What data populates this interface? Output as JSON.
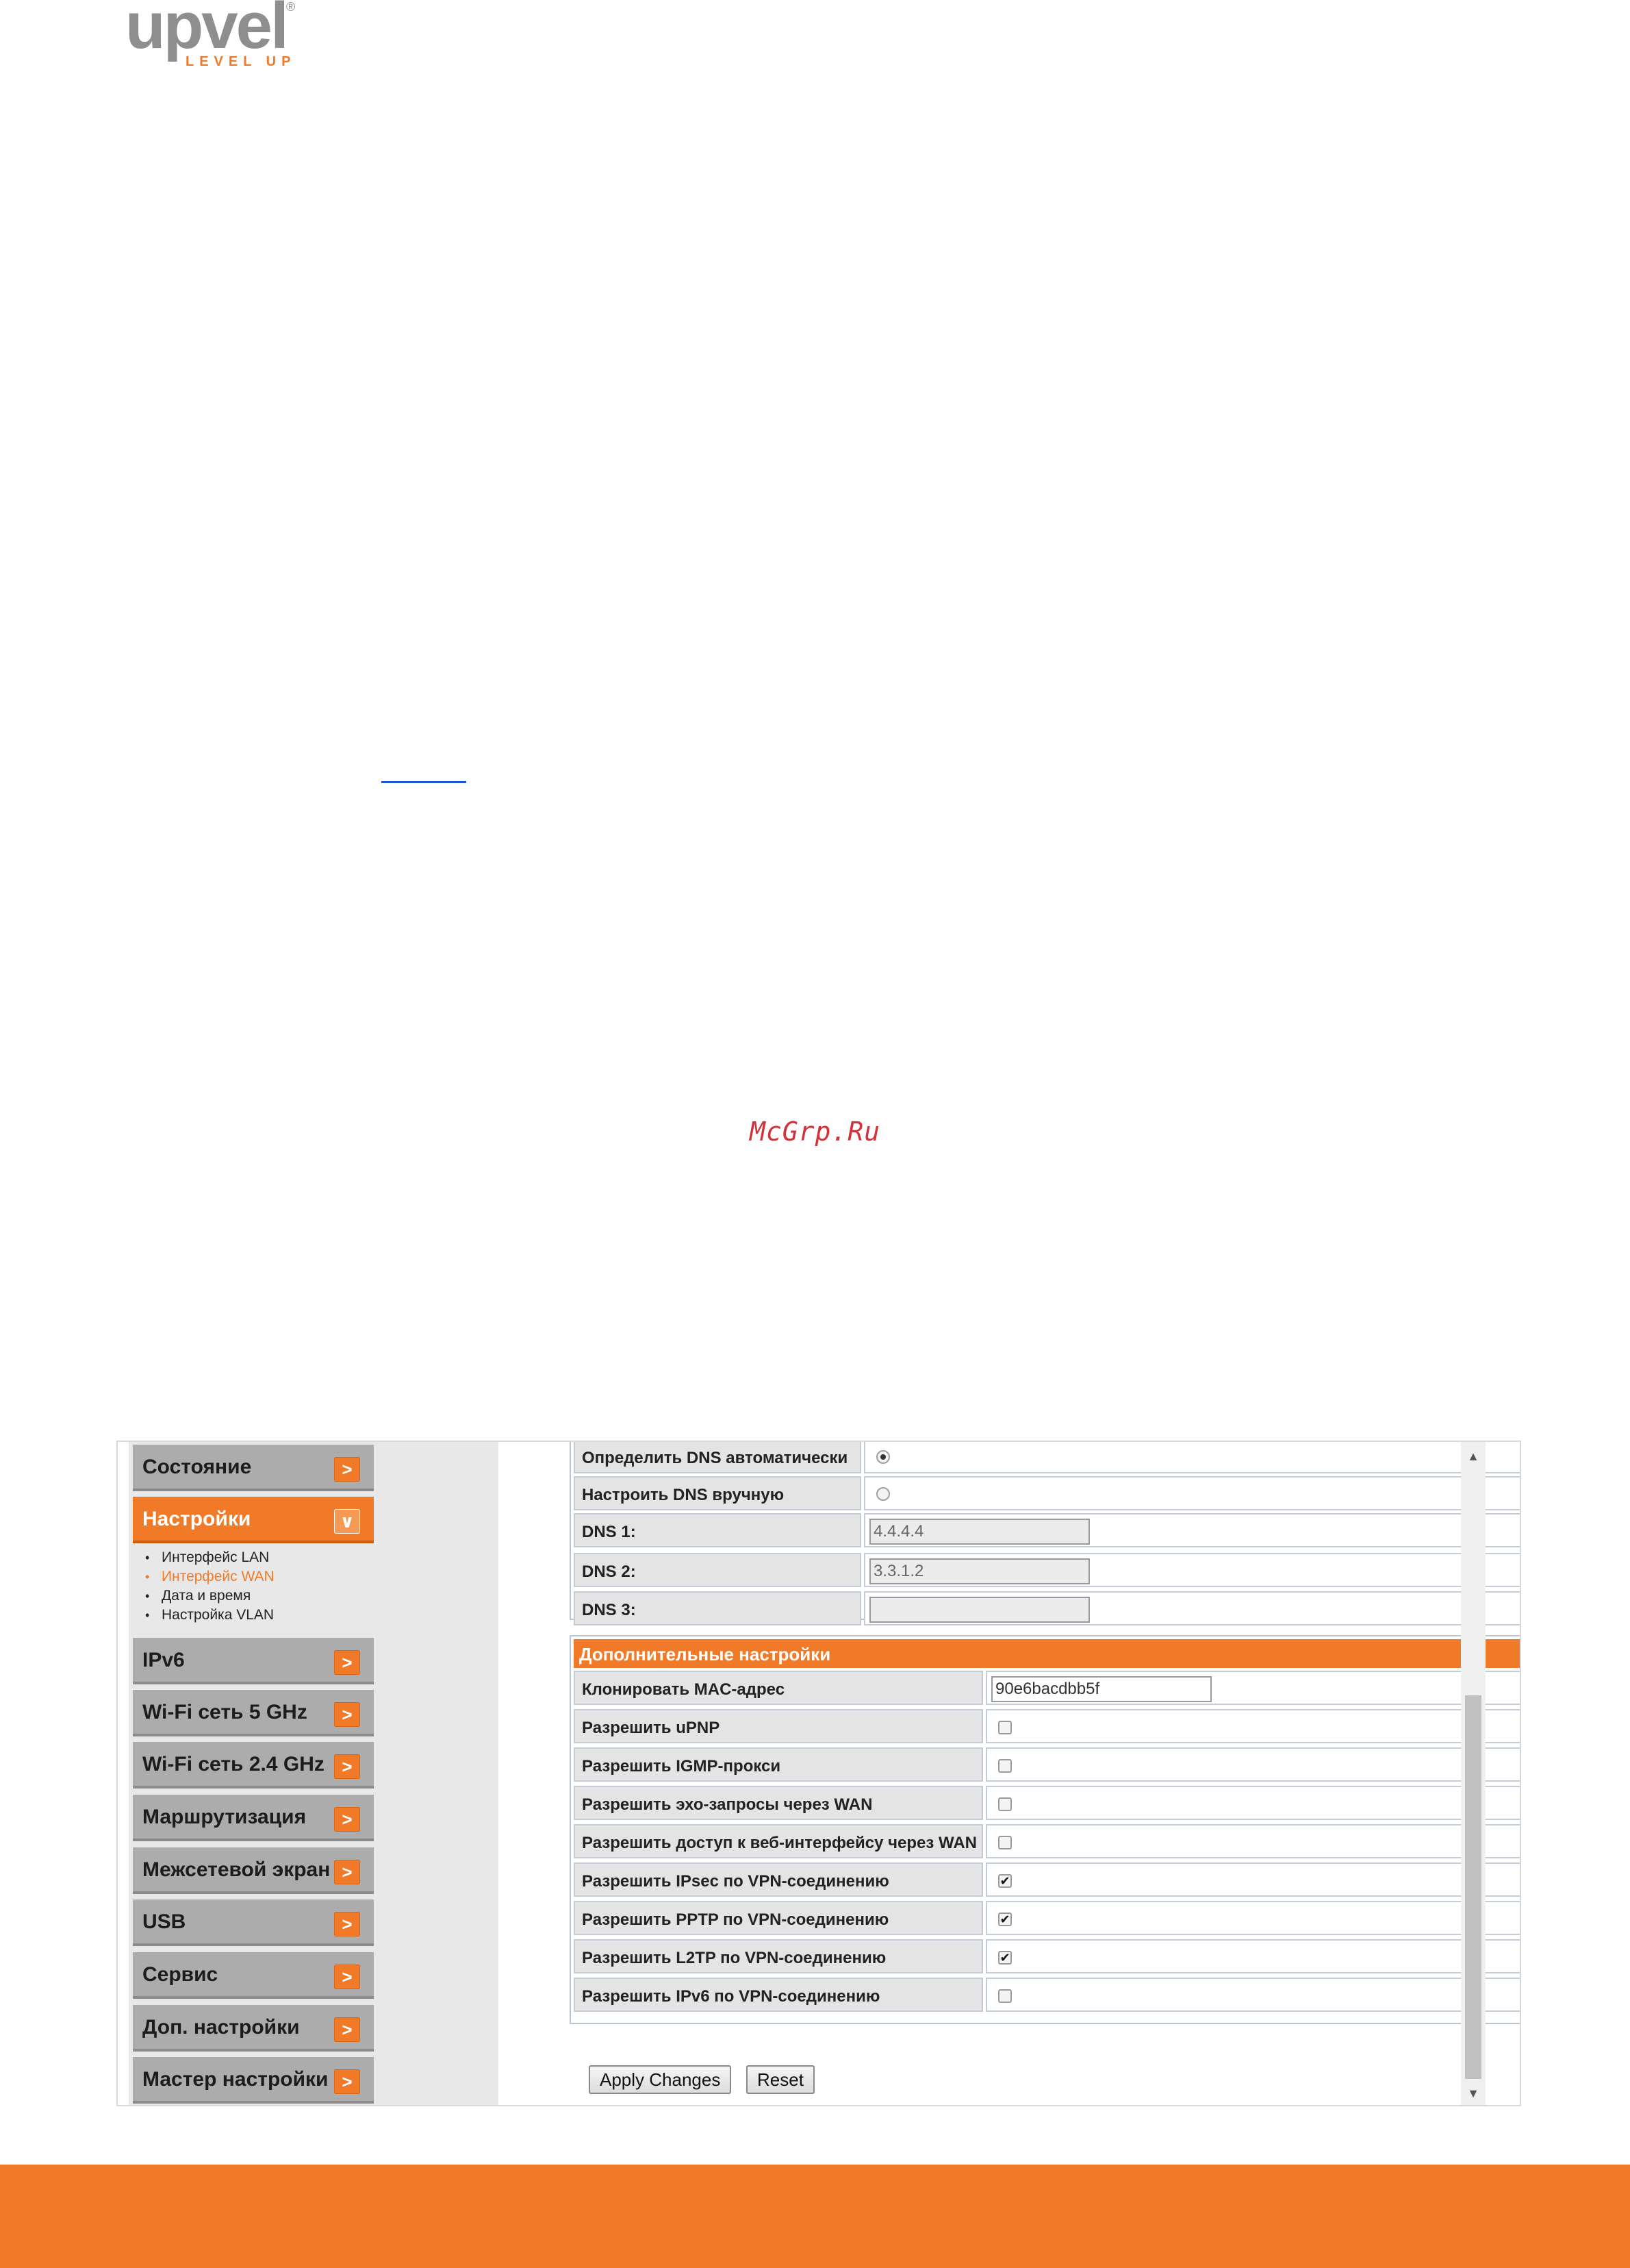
{
  "logo": {
    "word": "upvel",
    "registered": "®",
    "tagline": "LEVEL UP"
  },
  "watermark": "McGrp.Ru",
  "sidebar": {
    "items": [
      {
        "label": "Состояние",
        "arrow": ">"
      },
      {
        "label": "Настройки",
        "arrow": "∨"
      },
      {
        "label": "IPv6",
        "arrow": ">"
      },
      {
        "label": "Wi-Fi сеть 5 GHz",
        "arrow": ">"
      },
      {
        "label": "Wi-Fi сеть 2.4 GHz",
        "arrow": ">"
      },
      {
        "label": "Маршрутизация",
        "arrow": ">"
      },
      {
        "label": "Межсетевой экран",
        "arrow": ">"
      },
      {
        "label": "USB",
        "arrow": ">"
      },
      {
        "label": "Сервис",
        "arrow": ">"
      },
      {
        "label": "Доп. настройки",
        "arrow": ">"
      },
      {
        "label": "Мастер настройки",
        "arrow": ">"
      }
    ],
    "submenu": [
      "Интерфейс LAN",
      "Интерфейс WAN",
      "Дата и время",
      "Настройка VLAN"
    ]
  },
  "dns": {
    "auto_label": "Определить DNS автоматически",
    "manual_label": "Настроить DNS вручную",
    "dns1_label": "DNS 1:",
    "dns1_value": "4.4.4.4",
    "dns2_label": "DNS 2:",
    "dns2_value": "3.3.1.2",
    "dns3_label": "DNS 3:",
    "dns3_value": ""
  },
  "advanced": {
    "title": "Дополнительные настройки",
    "clone_mac_label": "Клонировать MAC-адрес",
    "clone_mac_value": "90e6bacdbb5f",
    "options": [
      {
        "label": "Разрешить uPNP",
        "checked": false,
        "mark": ""
      },
      {
        "label": "Разрешить IGMP-прокси",
        "checked": false,
        "mark": ""
      },
      {
        "label": "Разрешить эхо-запросы через WAN",
        "checked": false,
        "mark": ""
      },
      {
        "label": "Разрешить доступ к веб-интерфейсу через WAN",
        "checked": false,
        "mark": ""
      },
      {
        "label": "Разрешить IPsec по VPN-соединению",
        "checked": true,
        "mark": "✔"
      },
      {
        "label": "Разрешить PPTP по VPN-соединению",
        "checked": true,
        "mark": "✔"
      },
      {
        "label": "Разрешить L2TP по VPN-соединению",
        "checked": true,
        "mark": "✔"
      },
      {
        "label": "Разрешить IPv6 по VPN-соединению",
        "checked": false,
        "mark": ""
      }
    ]
  },
  "buttons": {
    "apply": "Apply Changes",
    "reset": "Reset"
  },
  "scrollbar": {
    "up": "▲",
    "down": "▼"
  },
  "colors": {
    "accent": "#f07a28",
    "sidebar_item": "#acacac",
    "cell_label": "#e4e4e4"
  }
}
